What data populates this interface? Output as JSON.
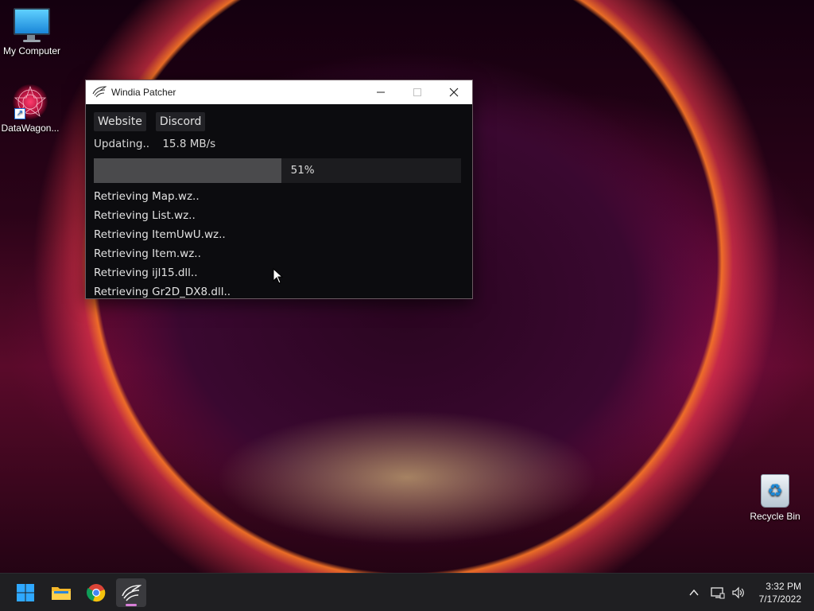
{
  "desktop": {
    "icons": [
      {
        "label": "My Computer",
        "icon": "monitor-icon"
      },
      {
        "label": "DataWagon...",
        "icon": "datawagon-icon"
      },
      {
        "label": "Recycle Bin",
        "icon": "recycle-bin-icon"
      }
    ]
  },
  "window": {
    "title": "Windia Patcher",
    "app_icon": "wing-icon",
    "controls": {
      "minimize": "minimize-icon",
      "maximize": "maximize-icon",
      "close": "close-icon"
    },
    "links": {
      "website": "Website",
      "discord": "Discord"
    },
    "status": "Updating..",
    "speed": "15.8 MB/s",
    "progress": {
      "value": 51,
      "label": "51%"
    },
    "log": [
      "Retrieving Map.wz..",
      "Retrieving List.wz..",
      "Retrieving ItemUwU.wz..",
      "Retrieving Item.wz..",
      "Retrieving ijl15.dll..",
      "Retrieving Gr2D_DX8.dll.."
    ]
  },
  "taskbar": {
    "items": [
      "start-icon",
      "file-explorer-icon",
      "chrome-icon",
      "windia-patcher-icon"
    ],
    "active": "windia-patcher-icon",
    "tray": [
      "chevron-up-icon",
      "network-icon",
      "volume-icon"
    ],
    "time": "3:32 PM",
    "date": "7/17/2022"
  },
  "colors": {
    "accent": "#d97fd9",
    "progress_fill": "#4a4a4c",
    "window_bg": "#0c0c0f"
  }
}
